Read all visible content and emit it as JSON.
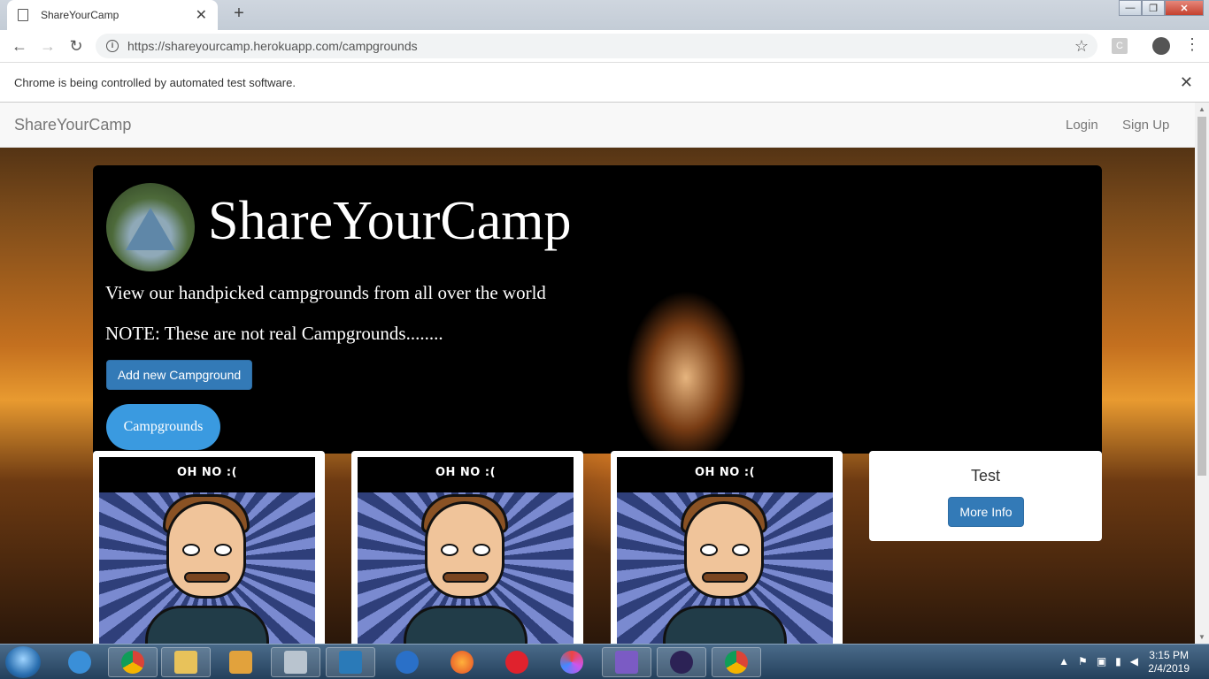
{
  "browser": {
    "tab_title": "ShareYourCamp",
    "tab_close": "✕",
    "new_tab": "+",
    "url": "https://shareyourcamp.herokuapp.com/campgrounds",
    "extension_letter": "C",
    "infobar_text": "Chrome is being controlled by automated test software.",
    "infobar_close": "✕",
    "window_controls": {
      "minimize": "—",
      "restore": "❐",
      "close": "✕"
    }
  },
  "navbar": {
    "brand": "ShareYourCamp",
    "login": "Login",
    "signup": "Sign Up"
  },
  "jumbotron": {
    "title": "ShareYourCamp",
    "subtitle": "View our handpicked campgrounds from all over the world",
    "note": "NOTE: These are not real Campgrounds........",
    "add_button": "Add new Campground",
    "pill": "Campgrounds"
  },
  "cards": [
    {
      "caption": "OH NO :("
    },
    {
      "caption": "OH NO :("
    },
    {
      "caption": "OH NO :("
    }
  ],
  "test_card": {
    "title": "Test",
    "button": "More Info"
  },
  "taskbar": {
    "apps": [
      "internet-explorer",
      "chrome",
      "file-explorer",
      "media-player",
      "printer",
      "hp",
      "thunderbird",
      "firefox",
      "opera",
      "app-spiral",
      "visual-studio",
      "eclipse",
      "chrome"
    ],
    "time": "3:15 PM",
    "date": "2/4/2019"
  }
}
